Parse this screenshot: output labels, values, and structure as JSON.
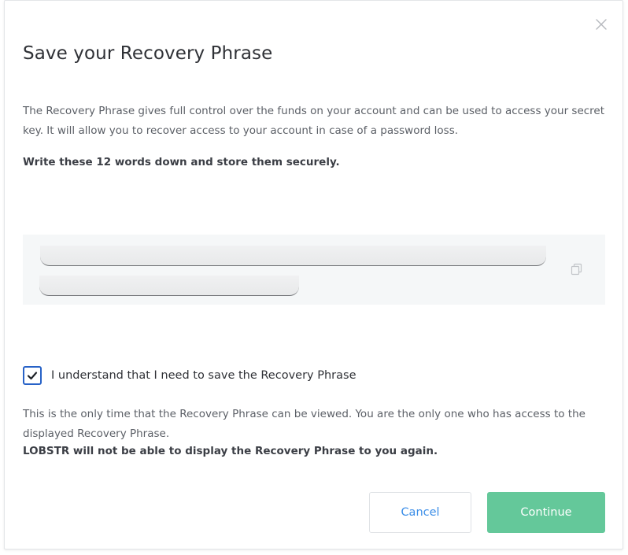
{
  "dialog": {
    "title": "Save your Recovery Phrase",
    "description": "The Recovery Phrase gives full control over the funds on your account and can be used to access your secret key. It will allow you to recover access to your account in case of a password loss.",
    "instruction": "Write these 12 words down and store them securely.",
    "close_icon": "close-icon"
  },
  "phrase": {
    "copy_icon": "copy-icon"
  },
  "confirmation": {
    "checked": true,
    "label": "I understand that I need to save the Recovery Phrase",
    "note": "This is the only time that the Recovery Phrase can be viewed. You are the only one who has access to the displayed Recovery Phrase.",
    "warning": "LOBSTR will not be able to display the Recovery Phrase to you again."
  },
  "actions": {
    "cancel_label": "Cancel",
    "continue_label": "Continue"
  },
  "colors": {
    "accent_blue": "#2762c7",
    "link_blue": "#3b8ee8",
    "continue_green": "#64c89a"
  }
}
